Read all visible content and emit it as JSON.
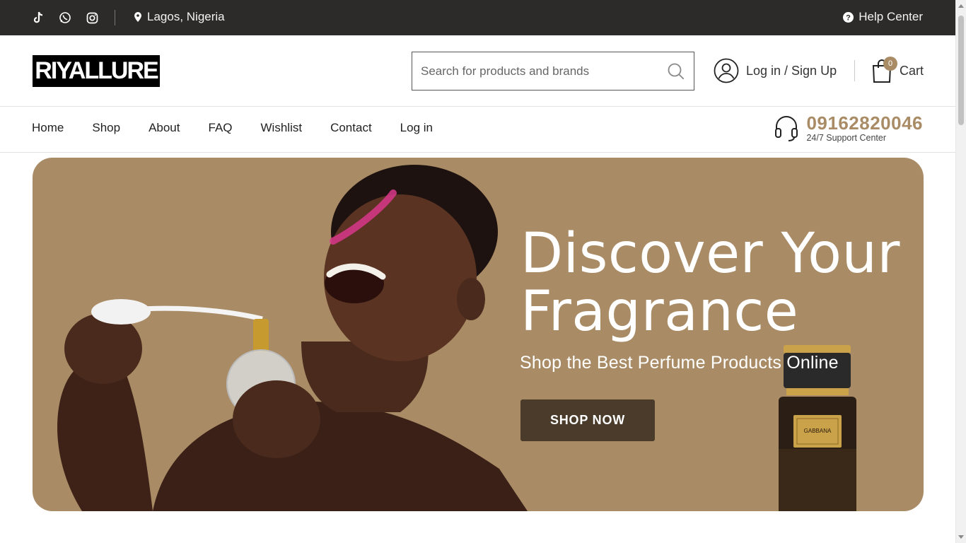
{
  "topbar": {
    "location": "Lagos, Nigeria",
    "help_label": "Help Center",
    "social_icons": [
      "tiktok-icon",
      "whatsapp-icon",
      "instagram-icon"
    ]
  },
  "header": {
    "logo_text": "RIYALLURE",
    "search": {
      "placeholder": "Search for products and brands",
      "value": ""
    },
    "account_label": "Log in / Sign Up",
    "cart": {
      "label": "Cart",
      "count": "0"
    }
  },
  "nav": {
    "items": [
      "Home",
      "Shop",
      "About",
      "FAQ",
      "Wishlist",
      "Contact",
      "Log in"
    ],
    "phone": "09162820046",
    "support_label": "24/7 Support Center"
  },
  "hero": {
    "headline_line1": "Discover Your",
    "headline_line2": "Fragrance",
    "tagline": "Shop the Best Perfume Products Online",
    "cta_label": "SHOP NOW",
    "bottle_brand": "GABBANA"
  },
  "colors": {
    "topbar_bg": "#2c2b29",
    "accent": "#a98c66",
    "cta_bg": "#4a3b2a"
  }
}
